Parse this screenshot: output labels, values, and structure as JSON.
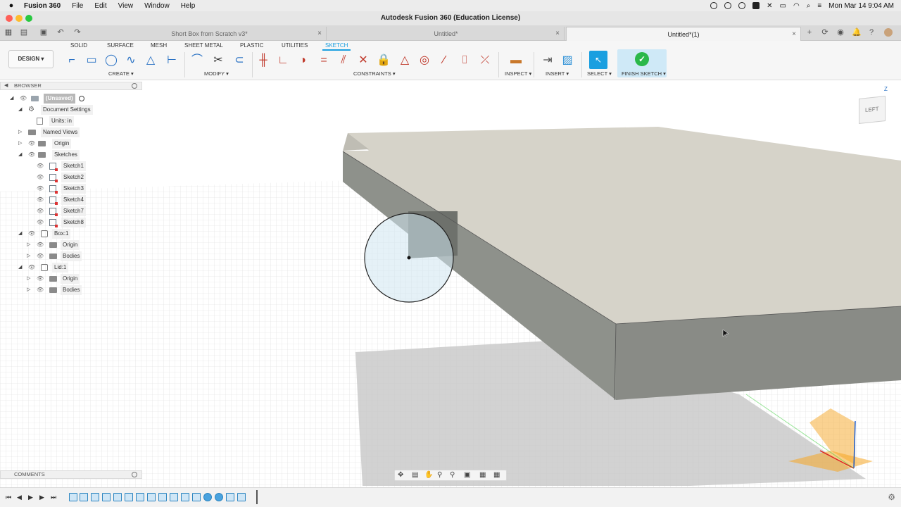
{
  "menubar": {
    "app_name": "Fusion 360",
    "items": [
      "File",
      "Edit",
      "View",
      "Window",
      "Help"
    ],
    "clock": "Mon Mar 14  9:04 AM"
  },
  "window": {
    "title": "Autodesk Fusion 360 (Education License)"
  },
  "tabs": [
    {
      "label": "Short Box from Scratch v3*",
      "active": false
    },
    {
      "label": "Untitled*",
      "active": false
    },
    {
      "label": "Untitled*(1)",
      "active": true
    }
  ],
  "toolbar": {
    "workspace_label": "DESIGN",
    "workspace_tabs": [
      "SOLID",
      "SURFACE",
      "MESH",
      "SHEET METAL",
      "PLASTIC",
      "UTILITIES",
      "SKETCH"
    ],
    "active_tab": "SKETCH",
    "groups": {
      "create": "CREATE",
      "modify": "MODIFY",
      "constraints": "CONSTRAINTS",
      "inspect": "INSPECT",
      "insert": "INSERT",
      "select": "SELECT",
      "finish": "FINISH SKETCH"
    }
  },
  "browser": {
    "header": "BROWSER",
    "items": [
      {
        "label": "(Unsaved)",
        "icon": "document-icon"
      },
      {
        "label": "Document Settings",
        "icon": "gear-icon"
      },
      {
        "label": "Units: in",
        "icon": "units-icon"
      },
      {
        "label": "Named Views",
        "icon": "folder-icon"
      },
      {
        "label": "Origin",
        "icon": "folder-icon"
      },
      {
        "label": "Sketches",
        "icon": "folder-icon"
      },
      {
        "label": "Sketch1",
        "icon": "sketch-icon"
      },
      {
        "label": "Sketch2",
        "icon": "sketch-icon"
      },
      {
        "label": "Sketch3",
        "icon": "sketch-icon"
      },
      {
        "label": "Sketch4",
        "icon": "sketch-icon"
      },
      {
        "label": "Sketch7",
        "icon": "sketch-icon"
      },
      {
        "label": "Sketch8",
        "icon": "sketch-icon"
      },
      {
        "label": "Box:1",
        "icon": "component-icon"
      },
      {
        "label": "Origin",
        "icon": "folder-icon"
      },
      {
        "label": "Bodies",
        "icon": "folder-icon"
      },
      {
        "label": "Lid:1",
        "icon": "component-icon"
      },
      {
        "label": "Origin",
        "icon": "folder-icon"
      },
      {
        "label": "Bodies",
        "icon": "folder-icon"
      }
    ]
  },
  "comments": {
    "label": "COMMENTS"
  },
  "viewcube": {
    "face_label": "LEFT",
    "axis_label": "Z"
  },
  "colors": {
    "accent": "#1a9fe0",
    "finish_sketch": "#2bb84a",
    "body_top": "#d4d1c6",
    "body_side": "#8f928c"
  }
}
